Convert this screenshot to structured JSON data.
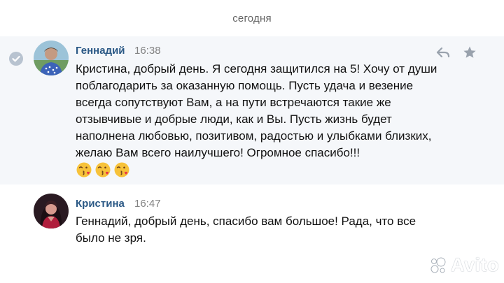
{
  "date_divider": "сегодня",
  "messages": [
    {
      "author": "Геннадий",
      "time": "16:38",
      "text": "Кристина, добрый день. Я сегодня защитился на 5! Хочу от души поблагодарить за оказанную помощь. Пусть удача и везение всегда сопутствуют Вам, а на пути встречаются такие же отзывчивые и добрые люди, как и Вы. Пусть жизнь будет наполнена любовью, позитивом, радостью и улыбками близких, желаю Вам всего наилучшего! Огромное спасибо!!!",
      "emojis": [
        "face-blowing-kiss",
        "face-blowing-kiss",
        "face-blowing-kiss"
      ]
    },
    {
      "author": "Кристина",
      "time": "16:47",
      "text": "Геннадий, добрый день, спасибо вам большое! Рада, что все было не зря."
    }
  ],
  "icons": {
    "selected": "check-icon",
    "reply": "reply-icon",
    "favorite": "star-icon"
  },
  "colors": {
    "author_link": "#2a5885",
    "meta_text": "#828282",
    "highlight_bg": "#f5f7fa",
    "check_bg": "#b8c3d0"
  },
  "watermark": "Avito"
}
